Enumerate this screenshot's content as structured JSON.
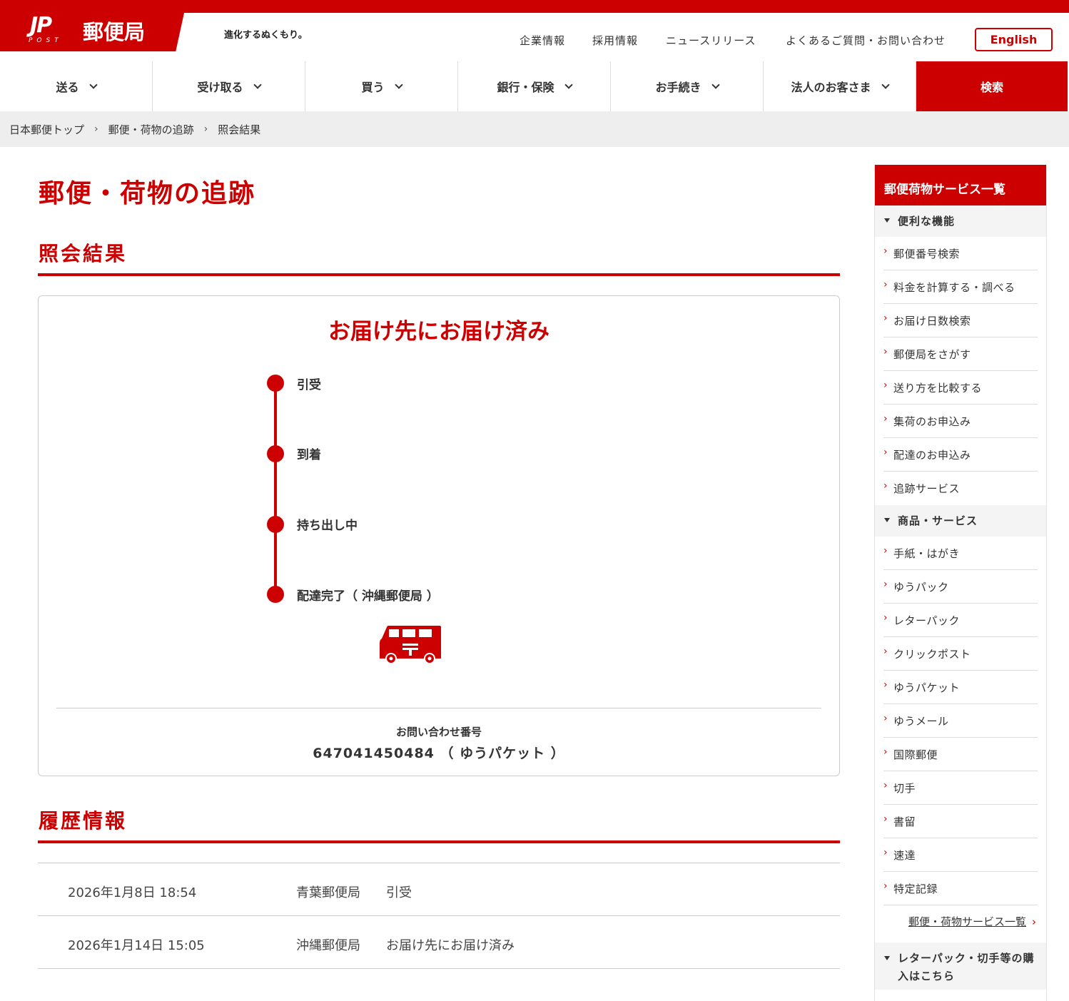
{
  "header": {
    "logo_mark": "JP",
    "logo_sub": "POST",
    "logo_name": "郵便局",
    "tagline": "進化するぬくもり。",
    "util_links": [
      "企業情報",
      "採用情報",
      "ニュースリリース",
      "よくあるご質問・お問い合わせ"
    ],
    "english_label": "English"
  },
  "nav": {
    "items": [
      "送る",
      "受け取る",
      "買う",
      "銀行・保険",
      "お手続き",
      "法人のお客さま"
    ],
    "search_label": "検索"
  },
  "breadcrumb": [
    "日本郵便トップ",
    "郵便・荷物の追跡",
    "照会結果"
  ],
  "main": {
    "page_title": "郵便・荷物の追跡",
    "result_section_title": "照会結果",
    "status_title": "お届け先にお届け済み",
    "steps": [
      "引受",
      "到着",
      "持ち出し中",
      "配達完了（ 沖縄郵便局 ）"
    ],
    "inquiry_label": "お問い合わせ番号",
    "inquiry_number": "647041450484 （ ゆうパケット ）",
    "history_section_title": "履歴情報",
    "history": [
      {
        "datetime": "2026年1月8日 18:54",
        "office": "青葉郵便局",
        "status": "引受"
      },
      {
        "datetime": "2026年1月14日 15:05",
        "office": "沖縄郵便局",
        "status": "お届け先にお届け済み"
      }
    ]
  },
  "sidebar": {
    "title": "郵便荷物サービス一覧",
    "category1": "便利な機能",
    "links1": [
      "郵便番号検索",
      "料金を計算する・調べる",
      "お届け日数検索",
      "郵便局をさがす",
      "送り方を比較する",
      "集荷のお申込み",
      "配達のお申込み",
      "追跡サービス"
    ],
    "category2": "商品・サービス",
    "links2": [
      "手紙・はがき",
      "ゆうパック",
      "レターパック",
      "クリックポスト",
      "ゆうパケット",
      "ゆうメール",
      "国際郵便",
      "切手",
      "書留",
      "速達",
      "特定記録"
    ],
    "all_services_link": "郵便・荷物サービス一覧",
    "category3": "レターパック・切手等の購入はこちら"
  },
  "colors": {
    "brand_red": "#cc0000",
    "breadcrumb_bg": "#eeeeee"
  },
  "icons": [
    "chevron-down-icon",
    "chevron-right-icon",
    "truck-icon",
    "triangle-down-icon"
  ]
}
